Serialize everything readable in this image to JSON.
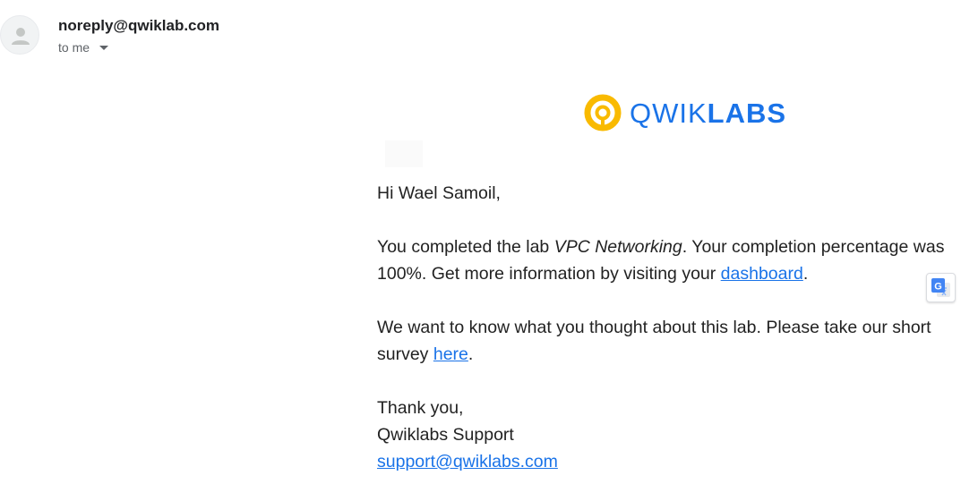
{
  "header": {
    "sender": "noreply@qwiklab.com",
    "recipient_label": "to me",
    "avatar_icon": "person-icon"
  },
  "logo": {
    "text_thin": "QWIK",
    "text_bold": "LABS",
    "icon": "qwiklabs-ring-icon",
    "ring_color": "#f9ba00",
    "text_color": "#1a73e8"
  },
  "message": {
    "greeting": "Hi Wael Samoil,",
    "para1_pre": "You completed the lab ",
    "para1_lab": "VPC Networking",
    "para1_mid": ". Your completion percentage was 100%. Get more information by visiting your ",
    "para1_link": "dashboard",
    "para1_post": ".",
    "para2_pre": "We want to know what you thought about this lab. Please take our short survey ",
    "para2_link": "here",
    "para2_post": ".",
    "signoff": "Thank you,",
    "signature": "Qwiklabs Support",
    "support_email": "support@qwiklabs.com"
  },
  "translate_button": {
    "icon": "google-translate-icon"
  },
  "colors": {
    "link": "#1a73e8",
    "text": "#222222",
    "muted": "#5f6368"
  }
}
